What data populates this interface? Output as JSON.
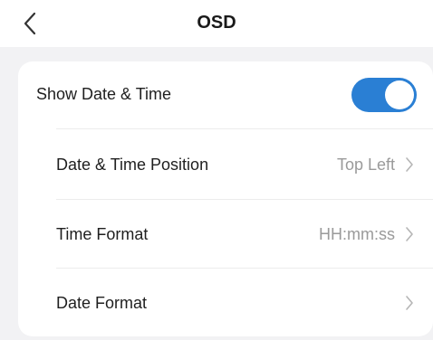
{
  "header": {
    "title": "OSD",
    "back_icon": "chevron-left-icon"
  },
  "settings": {
    "show_date_time": {
      "label": "Show Date & Time",
      "enabled": true,
      "accent": "#2a7fd4"
    },
    "items": [
      {
        "label": "Date & Time Position",
        "value": "Top Left",
        "icon": "chevron-right-icon"
      },
      {
        "label": "Time Format",
        "value": "HH:mm:ss",
        "icon": "chevron-right-icon"
      },
      {
        "label": "Date Format",
        "value": "",
        "icon": "chevron-right-icon"
      }
    ]
  }
}
